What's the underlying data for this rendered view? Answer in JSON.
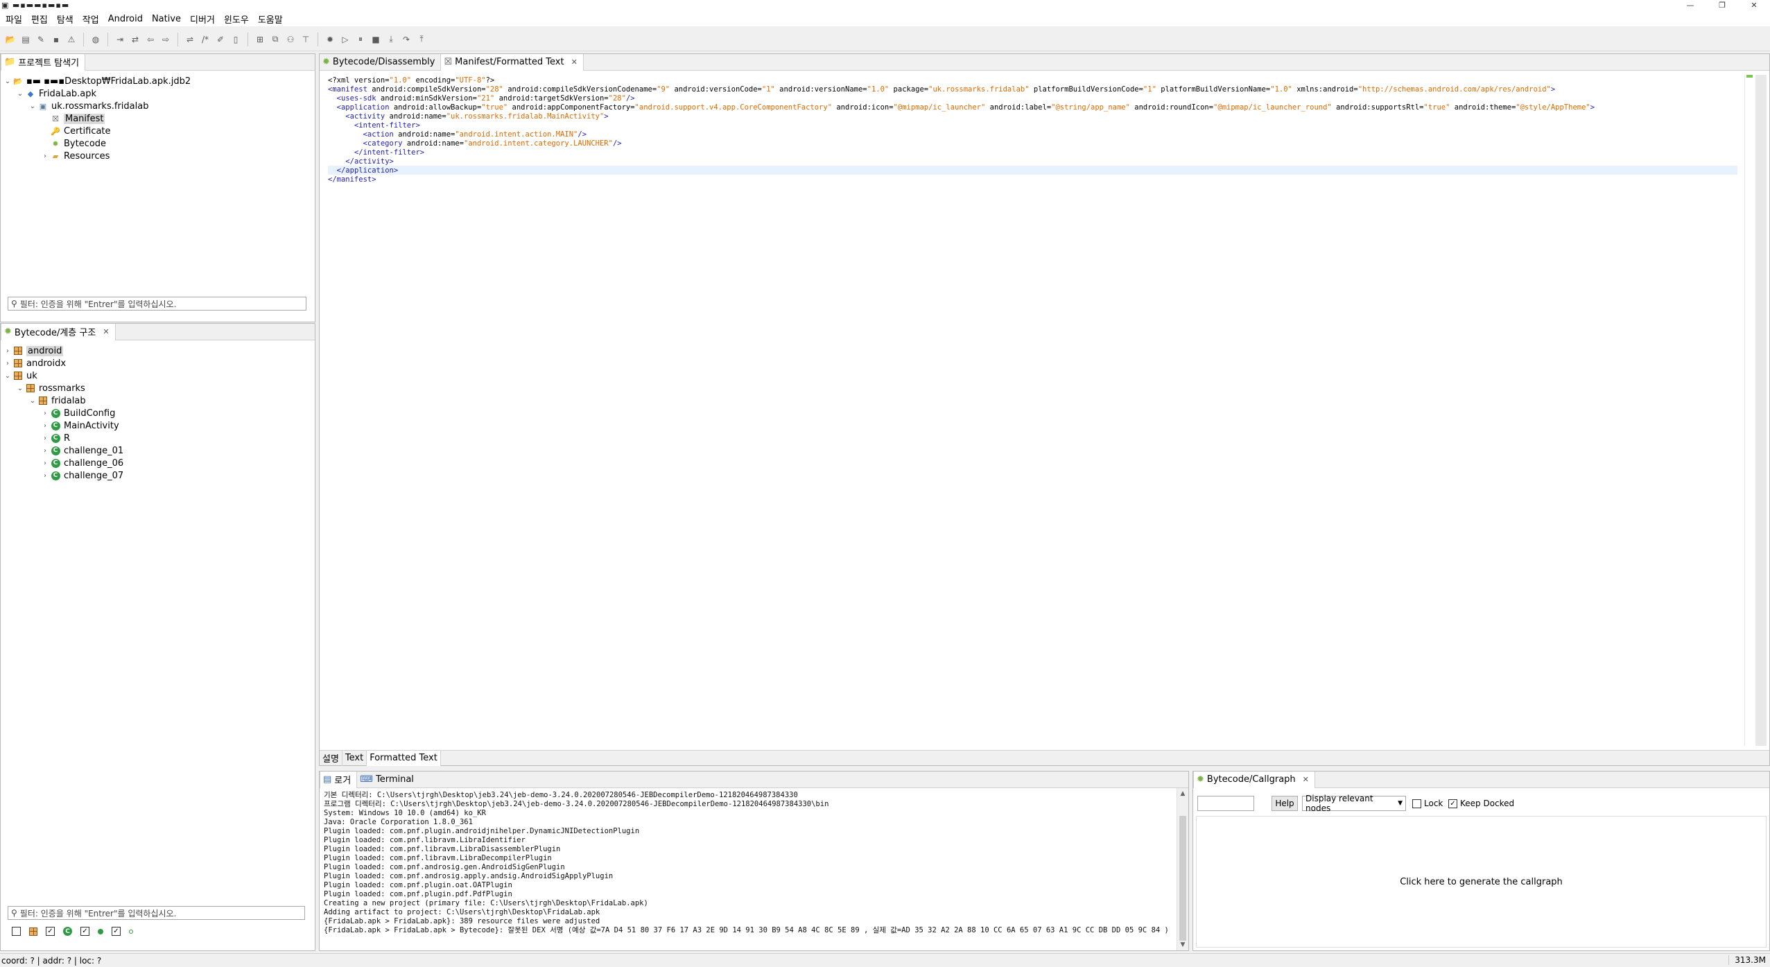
{
  "window": {
    "title_glyphs": "▣ ▬▪▬▬▪▬▪▬",
    "minimize": "—",
    "restore": "❐",
    "close": "✕"
  },
  "menu": [
    "파일",
    "편집",
    "탐색",
    "작업",
    "Android",
    "Native",
    "디버거",
    "윈도우",
    "도움말"
  ],
  "project_explorer": {
    "tab_label": "프로젝트 탐색기",
    "tree": [
      {
        "label": "▪▬ ▪▬▪Desktop₩FridaLab.apk.jdb2",
        "depth": 0,
        "twisty": "⌄",
        "icon": "project-icon",
        "selected": false
      },
      {
        "label": "FridaLab.apk",
        "depth": 1,
        "twisty": "⌄",
        "icon": "apk-icon",
        "selected": false
      },
      {
        "label": "uk.rossmarks.fridalab",
        "depth": 2,
        "twisty": "⌄",
        "icon": "android-icon",
        "selected": false
      },
      {
        "label": "Manifest",
        "depth": 3,
        "twisty": "",
        "icon": "manifest-icon",
        "selected": true
      },
      {
        "label": "Certificate",
        "depth": 3,
        "twisty": "",
        "icon": "certificate-icon",
        "selected": false
      },
      {
        "label": "Bytecode",
        "depth": 3,
        "twisty": "",
        "icon": "bytecode-icon",
        "selected": false
      },
      {
        "label": "Resources",
        "depth": 3,
        "twisty": "›",
        "icon": "folder-icon",
        "selected": false
      }
    ],
    "filter_placeholder": "필터: 인증을 위해 \"Entrer\"를 입력하십시오."
  },
  "hierarchy": {
    "tab_label": "Bytecode/계층 구조",
    "tree": [
      {
        "label": "android",
        "depth": 0,
        "twisty": "›",
        "icon": "package",
        "selected": true
      },
      {
        "label": "androidx",
        "depth": 0,
        "twisty": "›",
        "icon": "package",
        "selected": false
      },
      {
        "label": "uk",
        "depth": 0,
        "twisty": "⌄",
        "icon": "package",
        "selected": false
      },
      {
        "label": "rossmarks",
        "depth": 1,
        "twisty": "⌄",
        "icon": "package",
        "selected": false
      },
      {
        "label": "fridalab",
        "depth": 2,
        "twisty": "⌄",
        "icon": "package",
        "selected": false
      },
      {
        "label": "BuildConfig",
        "depth": 3,
        "twisty": "›",
        "icon": "class",
        "selected": false
      },
      {
        "label": "MainActivity",
        "depth": 3,
        "twisty": "›",
        "icon": "class",
        "selected": false
      },
      {
        "label": "R",
        "depth": 3,
        "twisty": "›",
        "icon": "class",
        "selected": false
      },
      {
        "label": "challenge_01",
        "depth": 3,
        "twisty": "›",
        "icon": "class",
        "selected": false
      },
      {
        "label": "challenge_06",
        "depth": 3,
        "twisty": "›",
        "icon": "class",
        "selected": false
      },
      {
        "label": "challenge_07",
        "depth": 3,
        "twisty": "›",
        "icon": "class",
        "selected": false
      }
    ],
    "filter_placeholder": "필터: 인증을 위해 \"Entrer\"를 입력하십시오."
  },
  "editor": {
    "tabs": [
      {
        "label": "Bytecode/Disassembly",
        "active": false
      },
      {
        "label": "Manifest/Formatted Text",
        "active": true
      }
    ],
    "bottom_tabs": [
      {
        "label": "설명",
        "active": false
      },
      {
        "label": "Text",
        "active": false
      },
      {
        "label": "Formatted Text",
        "active": true
      }
    ],
    "lines": [
      [
        [
          "t",
          "<?xml version="
        ],
        [
          "v",
          "\"1.0\""
        ],
        [
          "t",
          " encoding="
        ],
        [
          "v",
          "\"UTF-8\""
        ],
        [
          "t",
          "?>"
        ]
      ],
      [
        [
          "k",
          "<manifest"
        ],
        [
          "t",
          " android:compileSdkVersion="
        ],
        [
          "v",
          "\"28\""
        ],
        [
          "t",
          " android:compileSdkVersionCodename="
        ],
        [
          "v",
          "\"9\""
        ],
        [
          "t",
          " android:versionCode="
        ],
        [
          "v",
          "\"1\""
        ],
        [
          "t",
          " android:versionName="
        ],
        [
          "v",
          "\"1.0\""
        ],
        [
          "t",
          " package="
        ],
        [
          "v",
          "\"uk.rossmarks.fridalab\""
        ],
        [
          "t",
          " platformBuildVersionCode="
        ],
        [
          "v",
          "\"1\""
        ],
        [
          "t",
          " platformBuildVersionName="
        ],
        [
          "v",
          "\"1.0\""
        ],
        [
          "t",
          " xmlns:android="
        ],
        [
          "v",
          "\"http://schemas.android.com/apk/res/android\""
        ],
        [
          "k",
          ">"
        ]
      ],
      [
        [
          "t",
          "  "
        ],
        [
          "k",
          "<uses-sdk"
        ],
        [
          "t",
          " android:minSdkVersion="
        ],
        [
          "v",
          "\"21\""
        ],
        [
          "t",
          " android:targetSdkVersion="
        ],
        [
          "v",
          "\"28\""
        ],
        [
          "k",
          "/>"
        ]
      ],
      [
        [
          "t",
          "  "
        ],
        [
          "k",
          "<application"
        ],
        [
          "t",
          " android:allowBackup="
        ],
        [
          "v",
          "\"true\""
        ],
        [
          "t",
          " android:appComponentFactory="
        ],
        [
          "v",
          "\"android.support.v4.app.CoreComponentFactory\""
        ],
        [
          "t",
          " android:icon="
        ],
        [
          "v",
          "\"@mipmap/ic_launcher\""
        ],
        [
          "t",
          " android:label="
        ],
        [
          "v",
          "\"@string/app_name\""
        ],
        [
          "t",
          " android:roundIcon="
        ],
        [
          "v",
          "\"@mipmap/ic_launcher_round\""
        ],
        [
          "t",
          " android:supportsRtl="
        ],
        [
          "v",
          "\"true\""
        ],
        [
          "t",
          " android:theme="
        ],
        [
          "v",
          "\"@style/AppTheme\""
        ],
        [
          "k",
          ">"
        ]
      ],
      [
        [
          "t",
          "    "
        ],
        [
          "k",
          "<activity"
        ],
        [
          "t",
          " android:name="
        ],
        [
          "v",
          "\"uk.rossmarks.fridalab.MainActivity\""
        ],
        [
          "k",
          ">"
        ]
      ],
      [
        [
          "t",
          "      "
        ],
        [
          "k",
          "<intent-filter>"
        ]
      ],
      [
        [
          "t",
          "        "
        ],
        [
          "k",
          "<action"
        ],
        [
          "t",
          " android:name="
        ],
        [
          "v",
          "\"android.intent.action.MAIN\""
        ],
        [
          "k",
          "/>"
        ]
      ],
      [
        [
          "t",
          "        "
        ],
        [
          "k",
          "<category"
        ],
        [
          "t",
          " android:name="
        ],
        [
          "v",
          "\"android.intent.category.LAUNCHER\""
        ],
        [
          "k",
          "/>"
        ]
      ],
      [
        [
          "t",
          "      "
        ],
        [
          "k",
          "</intent-filter>"
        ]
      ],
      [
        [
          "t",
          "    "
        ],
        [
          "k",
          "</activity>"
        ]
      ],
      [
        [
          "t",
          "  "
        ],
        [
          "k",
          "</application>"
        ]
      ],
      [
        [
          "k",
          "</manifest>"
        ]
      ]
    ]
  },
  "console": {
    "tabs": [
      {
        "label": "로거",
        "active": true
      },
      {
        "label": "Terminal",
        "active": false
      }
    ],
    "lines": [
      "기본 디렉터리: C:\\Users\\tjrgh\\Desktop\\jeb3.24\\jeb-demo-3.24.0.202007280546-JEBDecompilerDemo-121820464987384330",
      "프로그램 디렉터리: C:\\Users\\tjrgh\\Desktop\\jeb3.24\\jeb-demo-3.24.0.202007280546-JEBDecompilerDemo-121820464987384330\\bin",
      "System: Windows 10 10.0 (amd64) ko_KR",
      "Java: Oracle Corporation 1.8.0_361",
      "Plugin loaded: com.pnf.plugin.androidjnihelper.DynamicJNIDetectionPlugin",
      "Plugin loaded: com.pnf.libravm.LibraIdentifier",
      "Plugin loaded: com.pnf.libravm.LibraDisassemblerPlugin",
      "Plugin loaded: com.pnf.libravm.LibraDecompilerPlugin",
      "Plugin loaded: com.pnf.androsig.gen.AndroidSigGenPlugin",
      "Plugin loaded: com.pnf.androsig.apply.andsig.AndroidSigApplyPlugin",
      "Plugin loaded: com.pnf.plugin.oat.OATPlugin",
      "Plugin loaded: com.pnf.plugin.pdf.PdfPlugin",
      "Creating a new project (primary file: C:\\Users\\tjrgh\\Desktop\\FridaLab.apk)",
      "Adding artifact to project: C:\\Users\\tjrgh\\Desktop\\FridaLab.apk",
      "{FridaLab.apk > FridaLab.apk}: 389 resource files were adjusted",
      "{FridaLab.apk > FridaLab.apk > Bytecode}: 잘못된 DEX 서명 (예상 값=7A D4 51 80 37 F6 17 A3 2E 9D 14 91 30 B9 54 A8 4C 8C 5E 89 , 실제 값=AD 35 32 A2 2A 88 10 CC 6A 65 07 63 A1 9C CC DB DD 05 9C 84 )"
    ]
  },
  "callgraph": {
    "tab_label": "Bytecode/Callgraph",
    "help_label": "Help",
    "select_value": "Display relevant nodes",
    "lock_label": "Lock",
    "lock_checked": false,
    "docked_label": "Keep Docked",
    "docked_checked": true,
    "hint": "Click here to generate the callgraph"
  },
  "status": {
    "coord": "coord: ? | addr: ? | loc: ?",
    "memory": "313.3M"
  },
  "colors": {
    "xml_tag": "#1d1db8",
    "xml_value": "#e06a00",
    "class_icon": "#2e9b43",
    "package_icon": "#e8b060"
  }
}
